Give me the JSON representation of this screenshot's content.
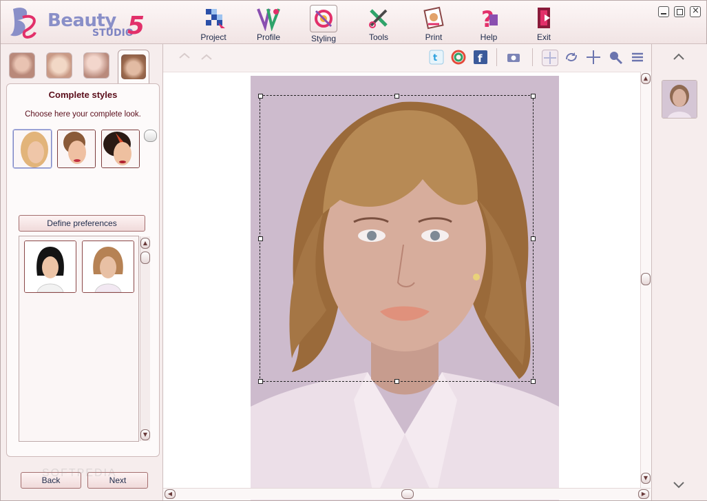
{
  "app": {
    "logo_word": "Beauty",
    "logo_sub": "STUDIO",
    "logo_version": "5"
  },
  "toolbar": {
    "items": [
      {
        "label": "Project",
        "icon": "project-icon"
      },
      {
        "label": "Profile",
        "icon": "profile-icon"
      },
      {
        "label": "Styling",
        "icon": "styling-icon",
        "active": true
      },
      {
        "label": "Tools",
        "icon": "tools-icon"
      },
      {
        "label": "Print",
        "icon": "print-icon"
      },
      {
        "label": "Help",
        "icon": "help-icon"
      },
      {
        "label": "Exit",
        "icon": "exit-icon"
      }
    ]
  },
  "left_panel": {
    "title": "Complete styles",
    "description": "Choose here your complete look.",
    "define_preferences_label": "Define preferences",
    "back_label": "Back",
    "next_label": "Next"
  },
  "canvas_toolbar": {
    "icons": [
      "undo-icon",
      "redo-icon",
      "twitter-icon",
      "picasa-icon",
      "facebook-icon",
      "camera-icon",
      "move-icon",
      "rotate-icon",
      "crosshair-icon",
      "zoom-icon",
      "menu-icon"
    ]
  },
  "watermark": "SOFTPEDIA",
  "colors": {
    "accent": "#e2306a",
    "logo_blue": "#8a8fc8",
    "panel_title": "#5a0d1a",
    "photo_bg": "#cdbbcd"
  }
}
